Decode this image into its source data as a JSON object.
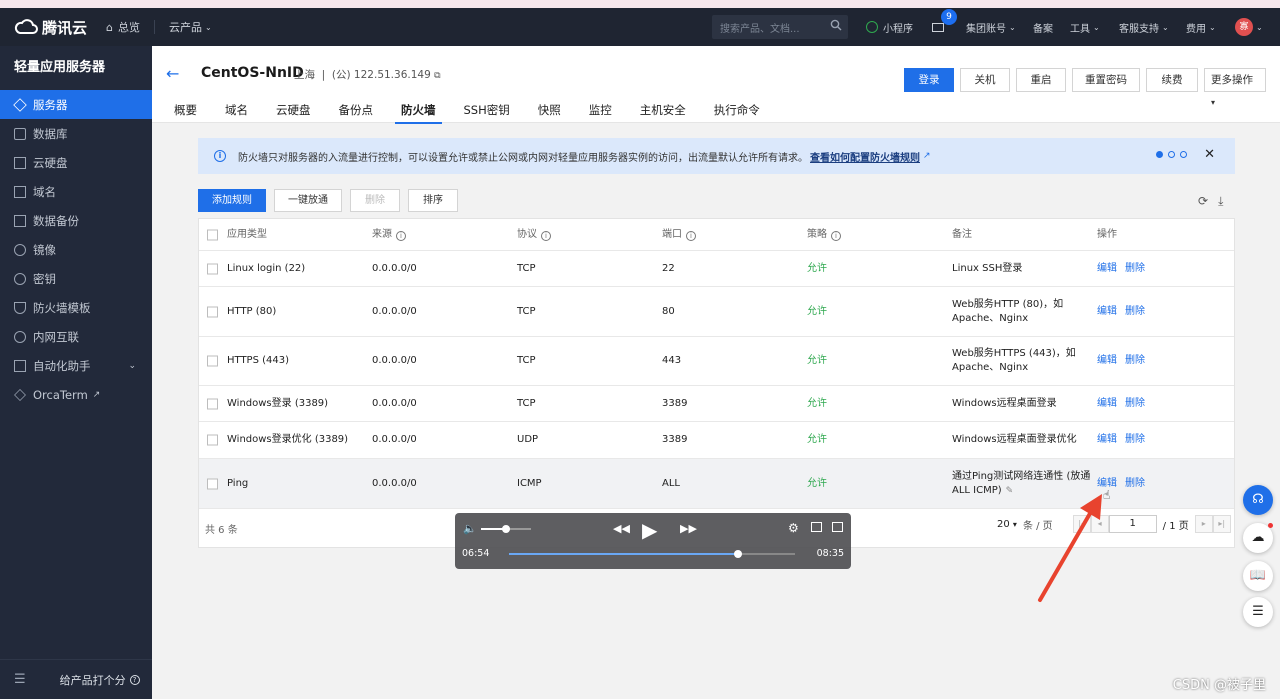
{
  "topnav": {
    "brand": "腾讯云",
    "overview": "总览",
    "products": "云产品",
    "search_placeholder": "搜索产品、文档...",
    "mini_program": "小程序",
    "message_count": "9",
    "group_account": "集团账号",
    "record": "备案",
    "tools": "工具",
    "support": "客服支持",
    "billing": "费用",
    "avatar_text": "寡"
  },
  "sidebar": {
    "title": "轻量应用服务器",
    "items": [
      {
        "label": "服务器",
        "icon": "cube-icon"
      },
      {
        "label": "数据库",
        "icon": "database-icon"
      },
      {
        "label": "云硬盘",
        "icon": "disk-icon"
      },
      {
        "label": "域名",
        "icon": "domain-icon"
      },
      {
        "label": "数据备份",
        "icon": "backup-icon"
      },
      {
        "label": "镜像",
        "icon": "image-icon"
      },
      {
        "label": "密钥",
        "icon": "key-icon"
      },
      {
        "label": "防火墙模板",
        "icon": "shield-icon"
      },
      {
        "label": "内网互联",
        "icon": "network-icon"
      },
      {
        "label": "自动化助手",
        "icon": "automation-icon"
      },
      {
        "label": "OrcaTerm",
        "icon": "terminal-icon"
      }
    ],
    "feedback": "给产品打个分"
  },
  "instance": {
    "name": "CentOS-NnID",
    "region": "上海",
    "ip": "(公) 122.51.36.149"
  },
  "actions": {
    "login": "登录",
    "shutdown": "关机",
    "restart": "重启",
    "reset_password": "重置密码",
    "renew": "续费",
    "more": "更多操作"
  },
  "tabs": [
    "概要",
    "域名",
    "云硬盘",
    "备份点",
    "防火墙",
    "SSH密钥",
    "快照",
    "监控",
    "主机安全",
    "执行命令"
  ],
  "banner": {
    "text": "防火墙只对服务器的入流量进行控制，可以设置允许或禁止公网或内网对轻量应用服务器实例的访问，出流量默认允许所有请求。",
    "link": "查看如何配置防火墙规则"
  },
  "toolbar": {
    "add_rule": "添加规则",
    "one_click": "一键放通",
    "delete": "删除",
    "sort": "排序"
  },
  "table": {
    "headers": {
      "app_type": "应用类型",
      "source": "来源",
      "protocol": "协议",
      "port": "端口",
      "policy": "策略",
      "remark": "备注",
      "operation": "操作"
    },
    "rows": [
      {
        "app": "Linux login (22)",
        "source": "0.0.0.0/0",
        "protocol": "TCP",
        "port": "22",
        "policy": "允许",
        "remark1": "Linux SSH登录",
        "remark2": "",
        "edit": "编辑",
        "del": "删除"
      },
      {
        "app": "HTTP (80)",
        "source": "0.0.0.0/0",
        "protocol": "TCP",
        "port": "80",
        "policy": "允许",
        "remark1": "Web服务HTTP (80)，如",
        "remark2": "Apache、Nginx",
        "edit": "编辑",
        "del": "删除"
      },
      {
        "app": "HTTPS (443)",
        "source": "0.0.0.0/0",
        "protocol": "TCP",
        "port": "443",
        "policy": "允许",
        "remark1": "Web服务HTTPS (443)，如",
        "remark2": "Apache、Nginx",
        "edit": "编辑",
        "del": "删除"
      },
      {
        "app": "Windows登录 (3389)",
        "source": "0.0.0.0/0",
        "protocol": "TCP",
        "port": "3389",
        "policy": "允许",
        "remark1": "Windows远程桌面登录",
        "remark2": "",
        "edit": "编辑",
        "del": "删除"
      },
      {
        "app": "Windows登录优化 (3389)",
        "source": "0.0.0.0/0",
        "protocol": "UDP",
        "port": "3389",
        "policy": "允许",
        "remark1": "Windows远程桌面登录优化",
        "remark2": "",
        "edit": "编辑",
        "del": "删除"
      },
      {
        "app": "Ping",
        "source": "0.0.0.0/0",
        "protocol": "ICMP",
        "port": "ALL",
        "policy": "允许",
        "remark1": "通过Ping测试网络连通性 (放通",
        "remark2": "ALL ICMP)",
        "edit": "编辑",
        "del": "删除"
      }
    ],
    "total": "共 6 条",
    "page_size": "20",
    "per_page": "条 / 页",
    "page": "1",
    "page_total": "/ 1 页"
  },
  "video": {
    "current_time": "06:54",
    "duration": "08:35",
    "progress": 0.8,
    "volume": 0.5
  },
  "watermark": "CSDN @被子里",
  "colors": {
    "accent": "#1f6fe8",
    "allow": "#2fa84f",
    "annotation": "#e8432e"
  }
}
